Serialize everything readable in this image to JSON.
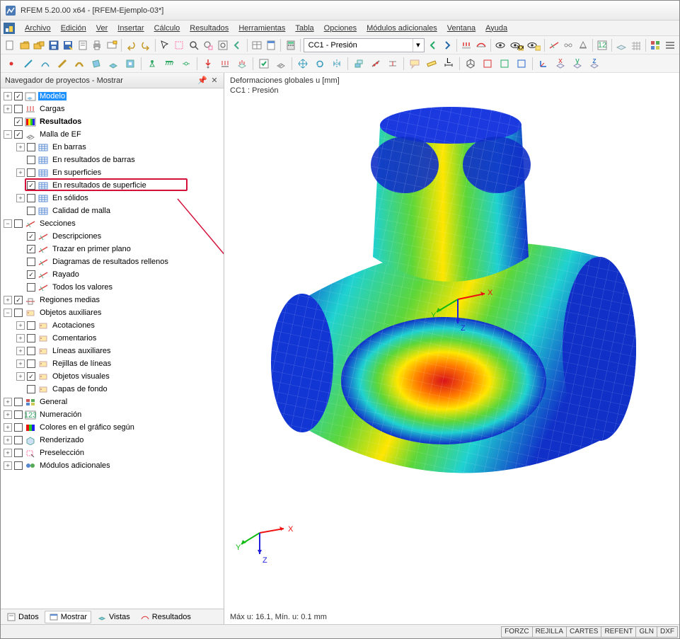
{
  "app": {
    "title": "RFEM 5.20.00 x64 - [RFEM-Ejemplo-03*]"
  },
  "menu": [
    "Archivo",
    "Edición",
    "Ver",
    "Insertar",
    "Cálculo",
    "Resultados",
    "Herramientas",
    "Tabla",
    "Opciones",
    "Módulos adicionales",
    "Ventana",
    "Ayuda"
  ],
  "loadcase": {
    "label": "CC1 - Presión"
  },
  "nav": {
    "title": "Navegador de proyectos - Mostrar",
    "tabs": [
      "Datos",
      "Mostrar",
      "Vistas",
      "Resultados"
    ],
    "active_tab": 1
  },
  "tree": [
    {
      "d": 0,
      "exp": "+",
      "chk": "v",
      "ic": "model",
      "t": "Modelo",
      "sel": true
    },
    {
      "d": 0,
      "exp": "+",
      "chk": "",
      "ic": "load",
      "t": "Cargas"
    },
    {
      "d": 0,
      "exp": "",
      "chk": "v",
      "ic": "res",
      "t": "Resultados",
      "bold": true
    },
    {
      "d": 0,
      "exp": "-",
      "chk": "v",
      "ic": "mesh",
      "t": "Malla de EF"
    },
    {
      "d": 1,
      "exp": "+",
      "chk": "",
      "ic": "grid",
      "t": "En barras"
    },
    {
      "d": 1,
      "exp": "",
      "chk": "",
      "ic": "grid",
      "t": "En resultados de barras"
    },
    {
      "d": 1,
      "exp": "+",
      "chk": "",
      "ic": "grid",
      "t": "En superficies"
    },
    {
      "d": 1,
      "exp": "",
      "chk": "v",
      "ic": "grid",
      "t": "En resultados de superficie",
      "hl": true
    },
    {
      "d": 1,
      "exp": "+",
      "chk": "",
      "ic": "grid",
      "t": "En sólidos"
    },
    {
      "d": 1,
      "exp": "",
      "chk": "",
      "ic": "grid",
      "t": "Calidad de malla"
    },
    {
      "d": 0,
      "exp": "-",
      "chk": "",
      "ic": "sec",
      "t": "Secciones"
    },
    {
      "d": 1,
      "exp": "",
      "chk": "v",
      "ic": "sec",
      "t": "Descripciones"
    },
    {
      "d": 1,
      "exp": "",
      "chk": "v",
      "ic": "sec",
      "t": "Trazar en primer plano"
    },
    {
      "d": 1,
      "exp": "",
      "chk": "",
      "ic": "sec",
      "t": "Diagramas de resultados rellenos"
    },
    {
      "d": 1,
      "exp": "",
      "chk": "v",
      "ic": "sec",
      "t": "Rayado"
    },
    {
      "d": 1,
      "exp": "",
      "chk": "",
      "ic": "sec",
      "t": "Todos los valores"
    },
    {
      "d": 0,
      "exp": "+",
      "chk": "v",
      "ic": "avg",
      "t": "Regiones medias"
    },
    {
      "d": 0,
      "exp": "-",
      "chk": "",
      "ic": "aux",
      "t": "Objetos auxiliares"
    },
    {
      "d": 1,
      "exp": "+",
      "chk": "",
      "ic": "aux",
      "t": "Acotaciones"
    },
    {
      "d": 1,
      "exp": "+",
      "chk": "",
      "ic": "aux",
      "t": "Comentarios"
    },
    {
      "d": 1,
      "exp": "+",
      "chk": "",
      "ic": "aux",
      "t": "Líneas auxiliares"
    },
    {
      "d": 1,
      "exp": "+",
      "chk": "",
      "ic": "aux",
      "t": "Rejillas de líneas"
    },
    {
      "d": 1,
      "exp": "+",
      "chk": "v",
      "ic": "aux",
      "t": "Objetos visuales"
    },
    {
      "d": 1,
      "exp": "",
      "chk": "",
      "ic": "aux",
      "t": "Capas de fondo"
    },
    {
      "d": 0,
      "exp": "+",
      "chk": "",
      "ic": "gen",
      "t": "General"
    },
    {
      "d": 0,
      "exp": "+",
      "chk": "",
      "ic": "num",
      "t": "Numeración"
    },
    {
      "d": 0,
      "exp": "+",
      "chk": "",
      "ic": "col",
      "t": "Colores en el gráfico según"
    },
    {
      "d": 0,
      "exp": "+",
      "chk": "",
      "ic": "ren",
      "t": "Renderizado"
    },
    {
      "d": 0,
      "exp": "+",
      "chk": "",
      "ic": "pre",
      "t": "Preselección"
    },
    {
      "d": 0,
      "exp": "+",
      "chk": "",
      "ic": "mod",
      "t": "Módulos adicionales"
    }
  ],
  "view": {
    "line1": "Deformaciones globales u [mm]",
    "line2": "CC1 : Presión",
    "status": "Máx u: 16.1, Mín. u: 0.1 mm"
  },
  "axes": {
    "x": "X",
    "y": "Y",
    "z": "Z"
  },
  "status": [
    "FORZC",
    "REJILLA",
    "CARTES",
    "REFENT",
    "GLN",
    "DXF"
  ]
}
